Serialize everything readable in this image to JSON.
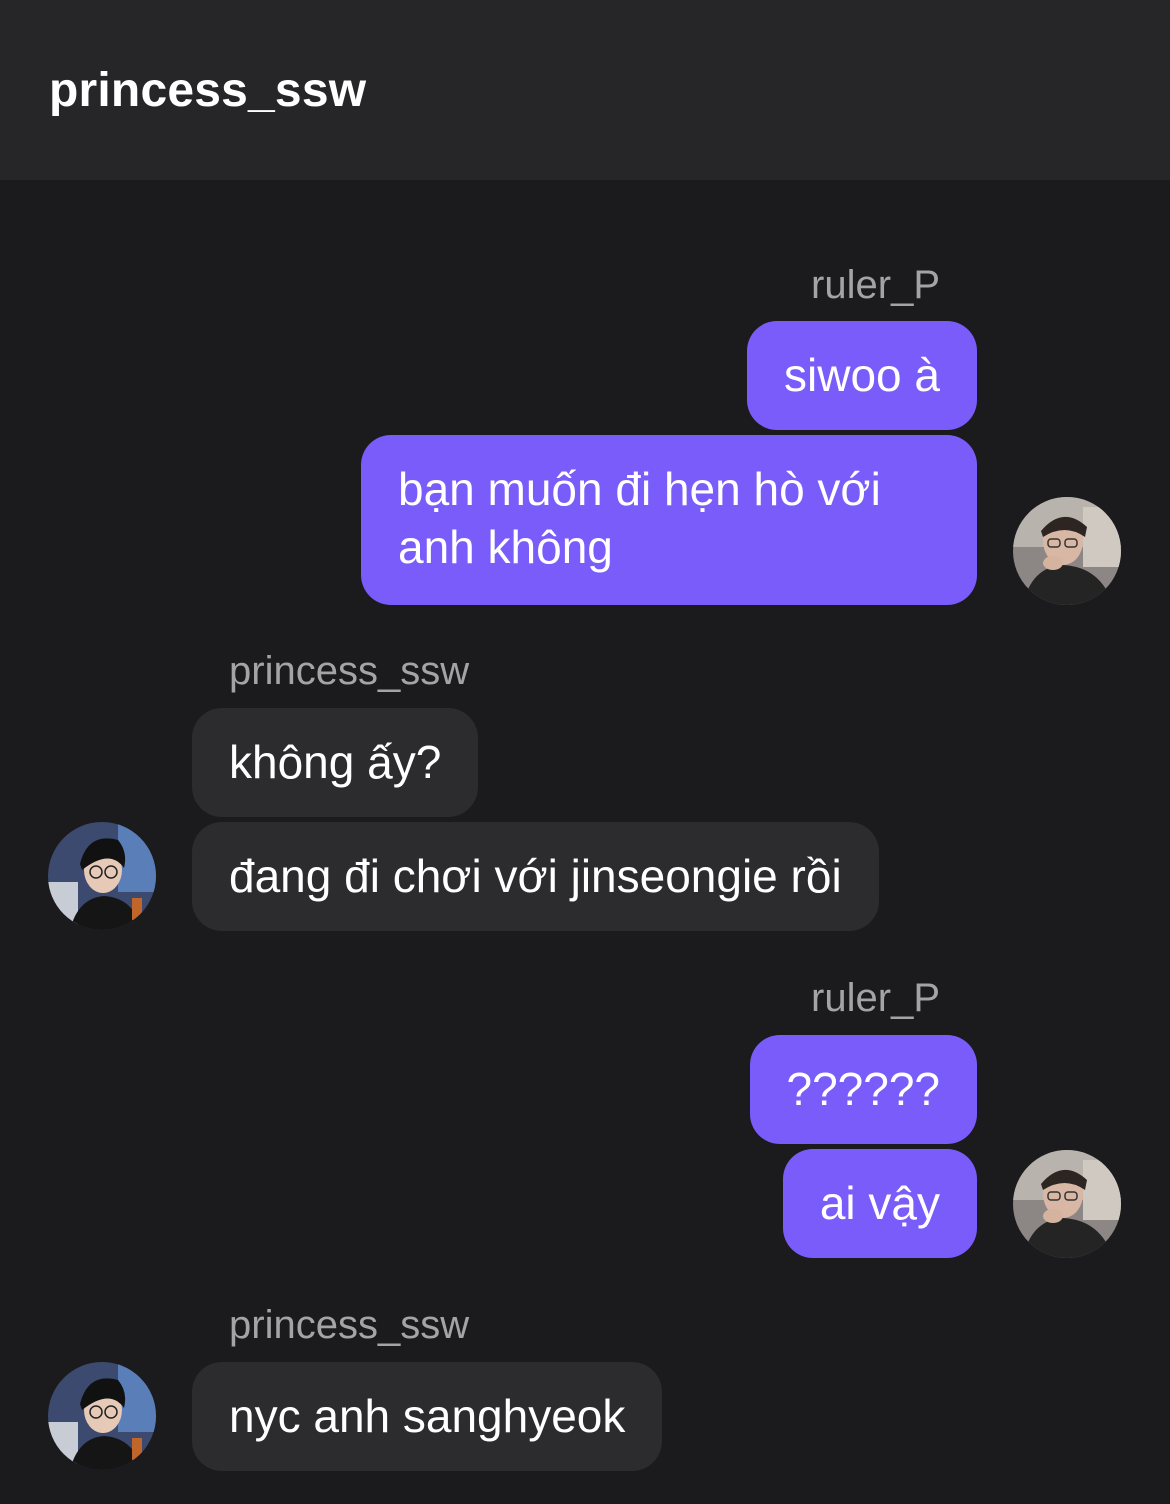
{
  "header": {
    "title": "princess_ssw"
  },
  "groups": [
    {
      "sender": "ruler_P",
      "messages": [
        "siwoo à",
        "bạn muốn đi hẹn hò với anh không"
      ]
    },
    {
      "sender": "princess_ssw",
      "messages": [
        "không ấy?",
        "đang đi chơi với jinseongie rồi"
      ]
    },
    {
      "sender": "ruler_P",
      "messages": [
        "??????",
        "ai vậy"
      ]
    },
    {
      "sender": "princess_ssw",
      "messages": [
        "nyc anh sanghyeok"
      ]
    }
  ],
  "colors": {
    "outgoing_bubble": "#7a5cfa",
    "incoming_bubble": "#2c2c2f",
    "background": "#1b1b1e",
    "header": "#262628"
  }
}
